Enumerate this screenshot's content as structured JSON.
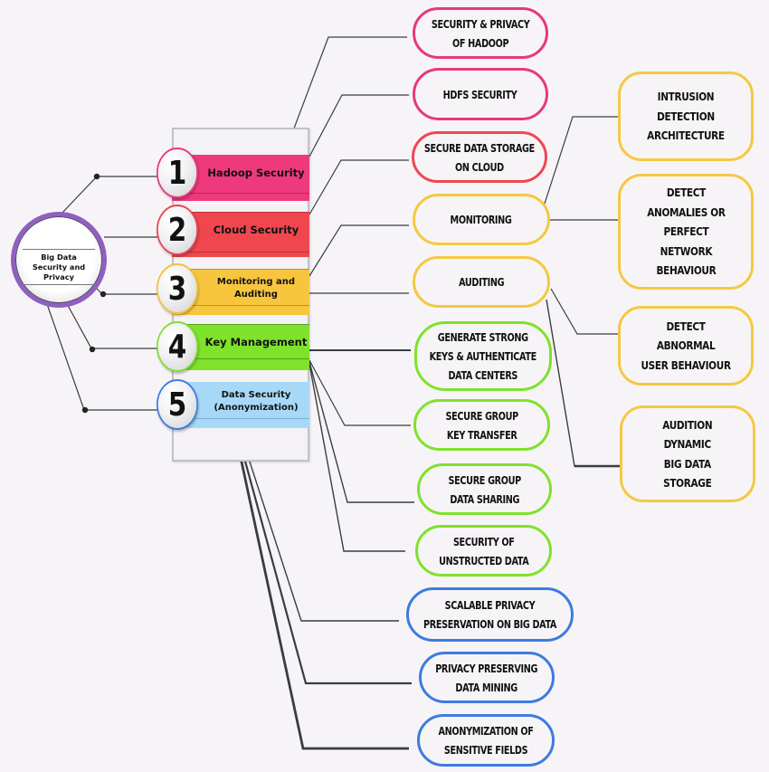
{
  "colors": {
    "background": "#f7f4f7",
    "hub_ring": "#9060c0",
    "hadoop": "#ee3a7c",
    "cloud": "#f0474f",
    "monitoring": "#f7c63e",
    "key": "#7fe22b",
    "data": "#a7d8f7",
    "data_ring": "#3d7be0",
    "connector": "#3a3d3f"
  },
  "hub": {
    "line1": "Big Data",
    "line2": "Security and Privacy"
  },
  "categories": [
    {
      "number": "1",
      "label": "Hadoop Security",
      "color": "#ee3a7c",
      "ring": "#e8387b"
    },
    {
      "number": "2",
      "label": "Cloud Security",
      "color": "#f0474f",
      "ring": "#e84650"
    },
    {
      "number": "3",
      "label": "Monitoring and Auditing",
      "color": "#f7c63e",
      "ring": "#f0c23c"
    },
    {
      "number": "4",
      "label": "Key Management",
      "color": "#7fe22b",
      "ring": "#82de32"
    },
    {
      "number": "5",
      "label": "Data Security (Anonymization)",
      "color": "#a7d8f7",
      "ring": "#3d7be0"
    }
  ],
  "topics": [
    {
      "text": "SECURITY & PRIVACY\nOF HADOOP",
      "category": 1
    },
    {
      "text": "HDFS SECURITY",
      "category": 1
    },
    {
      "text": "SECURE DATA STORAGE\nON CLOUD",
      "category": 2
    },
    {
      "text": "MONITORING",
      "category": 3
    },
    {
      "text": "AUDITING",
      "category": 3
    },
    {
      "text": "GENERATE STRONG\nKEYS & AUTHENTICATE\nDATA CENTERS",
      "category": 4
    },
    {
      "text": "SECURE GROUP\nKEY TRANSFER",
      "category": 4
    },
    {
      "text": "SECURE GROUP\nDATA SHARING",
      "category": 4
    },
    {
      "text": "SECURITY OF\nUNSTRUCTED DATA",
      "category": 4
    },
    {
      "text": "SCALABLE PRIVACY\nPRESERVATION ON BIG DATA",
      "category": 5
    },
    {
      "text": "PRIVACY PRESERVING\nDATA MINING",
      "category": 5
    },
    {
      "text": "ANONYMIZATION OF\nSENSITIVE FIELDS",
      "category": 5
    }
  ],
  "subtopics": [
    {
      "text": "INTRUSION\nDETECTION\nARCHITECTURE",
      "parent": "MONITORING"
    },
    {
      "text": "DETECT\nANOMALIES  OR\nPERFECT\nNETWORK\nBEHAVIOUR",
      "parent": "MONITORING"
    },
    {
      "text": "DETECT\nABNORMAL\nUSER BEHAVIOUR",
      "parent": "AUDITING"
    },
    {
      "text": "AUDITION\nDYNAMIC\nBIG DATA\nSTORAGE",
      "parent": "AUDITING"
    }
  ]
}
